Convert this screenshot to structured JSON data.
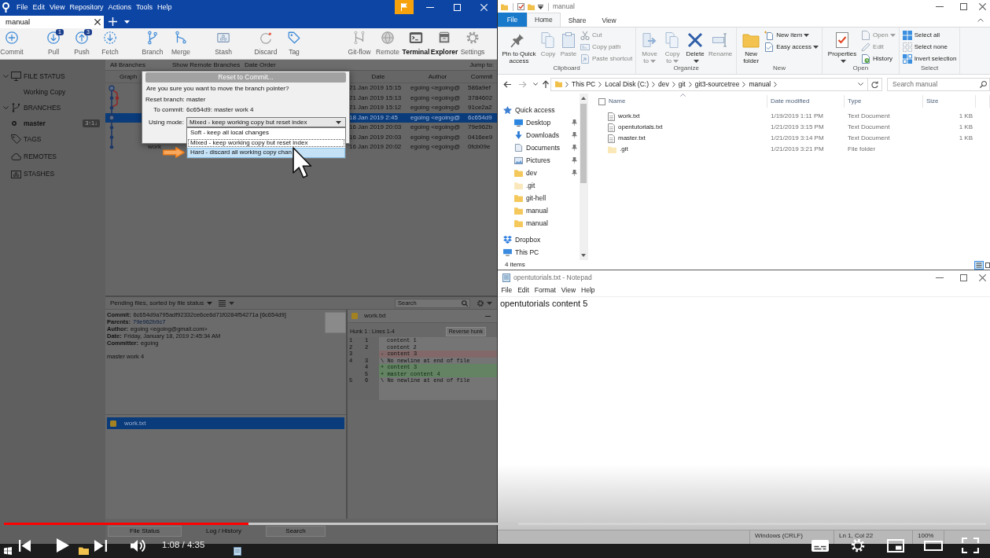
{
  "sourcetree": {
    "menu": [
      "File",
      "Edit",
      "View",
      "Repository",
      "Actions",
      "Tools",
      "Help"
    ],
    "tabs": [
      {
        "label": "manual",
        "selected": true
      }
    ],
    "toolbar": {
      "left": [
        {
          "items": [
            {
              "label": "Commit",
              "highlighted": false
            }
          ]
        },
        {
          "items": [
            {
              "label": "Pull",
              "badge": "1",
              "highlighted": false
            },
            {
              "label": "Push",
              "badge": "3",
              "highlighted": false
            },
            {
              "label": "Fetch",
              "highlighted": false
            }
          ]
        },
        {
          "items": [
            {
              "label": "Branch",
              "highlighted": false
            },
            {
              "label": "Merge",
              "highlighted": false
            }
          ]
        },
        {
          "items": [
            {
              "label": "Stash",
              "highlighted": false
            }
          ]
        },
        {
          "items": [
            {
              "label": "Discard",
              "highlighted": false
            },
            {
              "label": "Tag",
              "highlighted": false
            }
          ]
        }
      ],
      "right": [
        {
          "label": "Git-flow",
          "highlighted": false
        },
        {
          "label": "Remote",
          "highlighted": false
        },
        {
          "label": "Terminal",
          "highlighted": true
        },
        {
          "label": "Explorer",
          "highlighted": true
        },
        {
          "label": "Settings",
          "highlighted": false
        }
      ]
    },
    "sidebar": [
      {
        "label": "FILE STATUS",
        "expanded": true,
        "children": [
          {
            "label": "Working Copy",
            "current": false
          }
        ]
      },
      {
        "label": "BRANCHES",
        "expanded": true,
        "children": [
          {
            "label": "master",
            "current": true,
            "badge": "3↑1↓"
          }
        ]
      },
      {
        "label": "TAGS",
        "expanded": false
      },
      {
        "label": "REMOTES",
        "expanded": false
      },
      {
        "label": "STASHES",
        "expanded": false
      }
    ],
    "log": {
      "filters": [
        "All Branches",
        "Show Remote Branches",
        "Date Order"
      ],
      "jump_label": "Jump to:",
      "columns": [
        "Graph",
        "Date",
        "Author",
        "Commit"
      ],
      "rows": [
        {
          "date": "21 Jan 2019 15:15",
          "author": "egoing <egoing@",
          "commit": "586a9ef",
          "selected": false
        },
        {
          "date": "21 Jan 2019 15:13",
          "author": "egoing <egoing@",
          "commit": "3784602",
          "selected": false
        },
        {
          "date": "21 Jan 2019 15:12",
          "author": "egoing <egoing@",
          "commit": "91ce2a2",
          "selected": false
        },
        {
          "date": "18 Jan 2019 2:45",
          "author": "egoing <egoing@",
          "commit": "6c654d9",
          "selected": true
        },
        {
          "date": "16 Jan 2019 20:03",
          "author": "egoing <egoing@",
          "commit": "79e962b",
          "selected": false
        },
        {
          "date": "16 Jan 2019 20:03",
          "author": "egoing <egoing@",
          "commit": "0416ee9",
          "selected": false
        },
        {
          "description": "work",
          "date": "16 Jan 2019 20:02",
          "author": "egoing <egoing@",
          "commit": "0fcb09e",
          "selected": false
        }
      ]
    },
    "dialog": {
      "title": "Reset to Commit...",
      "question": "Are you sure you want to move the branch pointer?",
      "fields": [
        {
          "label": "Reset branch:",
          "value": "master"
        },
        {
          "label": "To commit:",
          "value": "6c654d9: master work 4"
        },
        {
          "label": "Using mode:",
          "value": "Mixed - keep working copy but reset index",
          "kind": "select"
        }
      ],
      "options": [
        {
          "label": "Soft - keep all local changes",
          "selected": false,
          "hovered": false
        },
        {
          "label": "Mixed - keep working copy but reset index",
          "selected": true,
          "hovered": false
        },
        {
          "label": "Hard - discard all working copy chan",
          "selected": false,
          "hovered": true
        }
      ]
    },
    "pending": {
      "label": "Pending files, sorted by file status",
      "search": {
        "placeholder": "Search"
      }
    },
    "details": {
      "fields": [
        {
          "label": "Commit:",
          "value": "6c654d9a795adf92332ce6ce6d71f0284f54271a [6c654d9]"
        },
        {
          "label": "Parents:",
          "value": "79e962b9c7",
          "kind": "link"
        },
        {
          "label": "Author:",
          "value": "egoing <egoing@gmail.com>"
        },
        {
          "label": "Date:",
          "value": "Friday, January 18, 2019 2:45:34 AM"
        },
        {
          "label": "Committer:",
          "value": "egoing"
        }
      ],
      "message": "master work 4",
      "files": [
        {
          "name": "work.txt",
          "selected": true
        }
      ]
    },
    "diff": {
      "file": "work.txt",
      "hunk": "Hunk 1 : Lines 1-4",
      "action": "Reverse hunk",
      "lines": [
        {
          "old": "1",
          "new": "1",
          "text": "content 1",
          "kind": "context"
        },
        {
          "old": "2",
          "new": "2",
          "text": "content 2",
          "kind": "context"
        },
        {
          "old": "3",
          "text": "- content 3",
          "kind": "removed"
        },
        {
          "old": "4",
          "new": "3",
          "text": "\\ No newline at end of file",
          "kind": "note"
        },
        {
          "new": "4",
          "text": "+ content 3",
          "kind": "added"
        },
        {
          "new": "5",
          "text": "+ master content 4",
          "kind": "added"
        },
        {
          "old": "5",
          "new": "6",
          "text": "\\ No newline at end of file",
          "kind": "note"
        }
      ]
    },
    "bottom_tabs": [
      {
        "label": "File Status",
        "selected": false
      },
      {
        "label": "Log / History",
        "selected": true
      },
      {
        "label": "Search",
        "selected": false
      }
    ]
  },
  "explorer": {
    "title": "manual",
    "tabs": [
      {
        "label": "File",
        "kind": "menu",
        "selected": false
      },
      {
        "label": "Home",
        "kind": "tab",
        "selected": true
      },
      {
        "label": "Share",
        "kind": "tab",
        "selected": false
      },
      {
        "label": "View",
        "kind": "tab",
        "selected": false
      }
    ],
    "ribbon": [
      {
        "label": "Clipboard",
        "large": [
          {
            "label": "Pin to Quick access",
            "disabled": false,
            "dropdown": false
          },
          {
            "label": "Copy",
            "disabled": true,
            "dropdown": false
          },
          {
            "label": "Paste",
            "disabled": true,
            "dropdown": false
          }
        ],
        "small": [
          {
            "label": "Cut",
            "disabled": true,
            "dropdown": false
          },
          {
            "label": "Copy path",
            "disabled": true,
            "dropdown": false
          },
          {
            "label": "Paste shortcut",
            "disabled": true,
            "dropdown": false
          }
        ]
      },
      {
        "label": "Organize",
        "large": [
          {
            "label": "Move to",
            "disabled": true,
            "dropdown": true
          },
          {
            "label": "Copy to",
            "disabled": true,
            "dropdown": true
          },
          {
            "label": "Delete",
            "disabled": false,
            "dropdown": true
          },
          {
            "label": "Rename",
            "disabled": true,
            "dropdown": false
          }
        ]
      },
      {
        "label": "New",
        "large": [
          {
            "label": "New folder",
            "disabled": false,
            "dropdown": false
          }
        ],
        "small": [
          {
            "label": "New item",
            "disabled": false,
            "dropdown": true
          },
          {
            "label": "Easy access",
            "disabled": false,
            "dropdown": true
          }
        ]
      },
      {
        "label": "Open",
        "large": [
          {
            "label": "Properties",
            "disabled": false,
            "dropdown": true
          }
        ],
        "small": [
          {
            "label": "Open",
            "disabled": true,
            "dropdown": true
          },
          {
            "label": "Edit",
            "disabled": true,
            "dropdown": false
          },
          {
            "label": "History",
            "disabled": false,
            "dropdown": false
          }
        ]
      },
      {
        "label": "Select",
        "small": [
          {
            "label": "Select all",
            "disabled": false,
            "dropdown": false
          },
          {
            "label": "Select none",
            "disabled": false,
            "dropdown": false
          },
          {
            "label": "Invert selection",
            "disabled": false,
            "dropdown": false
          }
        ]
      }
    ],
    "path": [
      "This PC",
      "Local Disk (C:)",
      "dev",
      "git",
      "git3-sourcetree",
      "manual"
    ],
    "search": {
      "placeholder": "Search manual"
    },
    "nav": [
      {
        "label": "Quick access",
        "children": [
          {
            "label": "Desktop",
            "pinned": true,
            "hidden": false
          },
          {
            "label": "Downloads",
            "pinned": true,
            "hidden": false
          },
          {
            "label": "Documents",
            "pinned": true,
            "hidden": false
          },
          {
            "label": "Pictures",
            "pinned": true,
            "hidden": false
          },
          {
            "label": "dev",
            "pinned": true,
            "hidden": false
          },
          {
            "label": ".git",
            "pinned": false,
            "hidden": true
          },
          {
            "label": "git-hell",
            "pinned": false,
            "hidden": false
          },
          {
            "label": "manual",
            "pinned": false,
            "hidden": false
          },
          {
            "label": "manual",
            "pinned": false,
            "hidden": false
          }
        ]
      },
      {
        "label": "Dropbox"
      },
      {
        "label": "This PC"
      }
    ],
    "select_all": {
      "checked": false
    },
    "columns": [
      "Name",
      "Date modified",
      "Type",
      "Size"
    ],
    "files": [
      {
        "name": "work.txt",
        "modified": "1/19/2019 1:11 PM",
        "type": "Text Document",
        "size": "1 KB",
        "kind": "file",
        "hidden": false
      },
      {
        "name": "opentutorials.txt",
        "modified": "1/21/2019 3:15 PM",
        "type": "Text Document",
        "size": "1 KB",
        "kind": "file",
        "hidden": false
      },
      {
        "name": "master.txt",
        "modified": "1/21/2019 3:14 PM",
        "type": "Text Document",
        "size": "1 KB",
        "kind": "file",
        "hidden": false
      },
      {
        "name": ".git",
        "modified": "1/21/2019 3:21 PM",
        "type": "File folder",
        "kind": "folder",
        "hidden": true
      }
    ],
    "status": "4 items"
  },
  "notepad": {
    "title": "opentutorials.txt - Notepad",
    "menu": [
      "File",
      "Edit",
      "Format",
      "View",
      "Help"
    ],
    "text": "opentutorials content 5",
    "status": [
      "Windows (CRLF)",
      "Ln 1, Col 22",
      "100%"
    ]
  },
  "player": {
    "progress": {
      "level": 0.249
    },
    "buffered": {
      "level": 0.524
    },
    "time": "1:08 / 4:35"
  }
}
